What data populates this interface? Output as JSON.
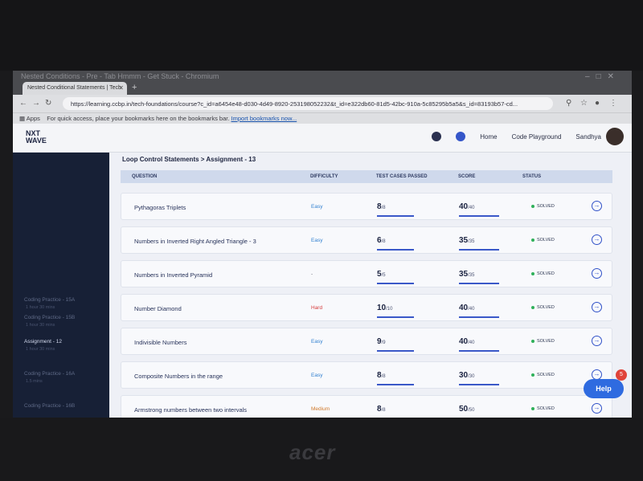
{
  "browser": {
    "window_title": "Nested Conditions - Pre - Tab Hmmm - Get Stuck - Chromium",
    "tab_title": "Nested Conditional Statements | Tech",
    "url": "https://learning.ccbp.in/tech-foundations/course?c_id=a6454e48-d030-4d49-8920-253198052232&t_id=e322db60-81d5-42bc-910a-5c85295b5a5&s_id=83193b57-cd...",
    "bookmarks_prefix": "Apps",
    "bookmarks_text": "For quick access, place your bookmarks here on the bookmarks bar.",
    "bookmarks_link": "Import bookmarks now..."
  },
  "header": {
    "logo_line1": "NXT",
    "logo_line2": "WAVE",
    "nav_home": "Home",
    "nav_playground": "Code Playground",
    "user_name": "Sandhya"
  },
  "sidebar": {
    "items": [
      {
        "label": "Coding Practice - 15A",
        "sub": "1 hour 30 mins"
      },
      {
        "label": "Coding Practice - 15B",
        "sub": "1 hour 30 mins"
      },
      {
        "label": "Assignment - 12",
        "sub": "1 hour 30 mins"
      },
      {
        "label": "Coding Practice - 16A",
        "sub": "1.5 mins"
      },
      {
        "label": "Coding Practice - 16B",
        "sub": "1.5 mins"
      }
    ]
  },
  "main": {
    "breadcrumb": "Loop Control Statements > Assignment - 13",
    "columns": {
      "question": "QUESTION",
      "difficulty": "DIFFICULTY",
      "tests": "TEST CASES PASSED",
      "score": "SCORE",
      "status": "STATUS"
    },
    "rows": [
      {
        "q": "Pythagoras Triplets",
        "diff": "Easy",
        "tp": "8",
        "tt": "/8",
        "sp": "40",
        "st": "/40",
        "status": "SOLVED"
      },
      {
        "q": "Numbers in Inverted Right Angled Triangle - 3",
        "diff": "Easy",
        "tp": "6",
        "tt": "/8",
        "sp": "35",
        "st": "/35",
        "status": "SOLVED"
      },
      {
        "q": "Numbers in Inverted Pyramid",
        "diff": "-",
        "tp": "5",
        "tt": "/5",
        "sp": "35",
        "st": "/35",
        "status": "SOLVED"
      },
      {
        "q": "Number Diamond",
        "diff": "Hard",
        "tp": "10",
        "tt": "/10",
        "sp": "40",
        "st": "/40",
        "status": "SOLVED"
      },
      {
        "q": "Indivisible Numbers",
        "diff": "Easy",
        "tp": "9",
        "tt": "/9",
        "sp": "40",
        "st": "/40",
        "status": "SOLVED"
      },
      {
        "q": "Composite Numbers in the range",
        "diff": "Easy",
        "tp": "8",
        "tt": "/8",
        "sp": "30",
        "st": "/30",
        "status": "SOLVED"
      },
      {
        "q": "Armstrong numbers between two intervals",
        "diff": "Medium",
        "tp": "8",
        "tt": "/8",
        "sp": "50",
        "st": "/50",
        "status": "SOLVED"
      }
    ],
    "difficulty_colors": {
      "Easy": "#2f7fd0",
      "Hard": "#d63c3c",
      "Medium": "#d0792a",
      "-": "#666a78"
    }
  },
  "help": {
    "label": "Help",
    "badge": "5"
  },
  "bezel": {
    "brand": "acer"
  }
}
